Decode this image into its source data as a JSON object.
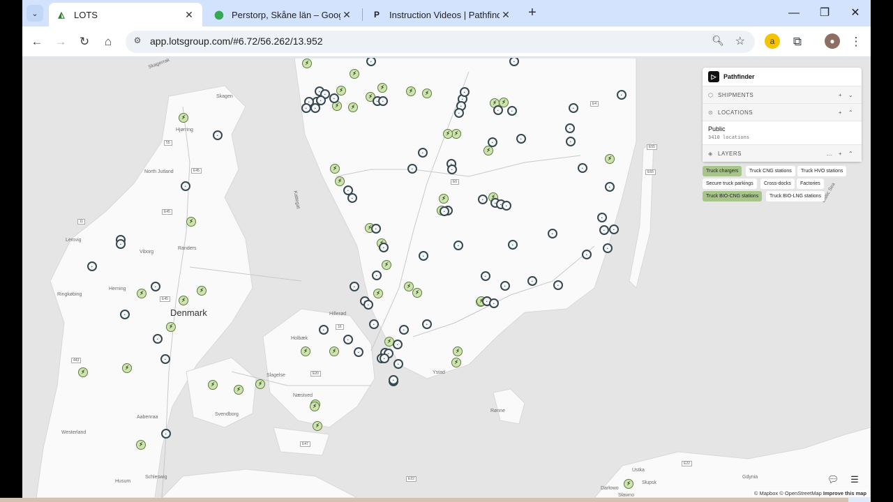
{
  "tabs": [
    {
      "title": "LOTS",
      "favicon": "lots-logo",
      "active": true
    },
    {
      "title": "Perstorp, Skåne län – Google M",
      "favicon": "google-maps-pin"
    },
    {
      "title": "Instruction Videos | Pathfinder",
      "favicon": "P"
    }
  ],
  "address_bar": {
    "url": "app.lotsgroup.com/#6.72/56.262/13.952"
  },
  "panel": {
    "title": "Pathfinder",
    "sections": {
      "shipments": "SHIPMENTS",
      "locations": "LOCATIONS",
      "layers": "LAYERS"
    },
    "location_item": {
      "title": "Public",
      "count": "3410 locations"
    },
    "layer_chips": [
      {
        "label": "Truck chargers",
        "active": true
      },
      {
        "label": "Truck CNG stations",
        "active": false
      },
      {
        "label": "Truck HVO stations",
        "active": false
      },
      {
        "label": "Secure truck parkings",
        "active": false
      },
      {
        "label": "Cross-docks",
        "active": false
      },
      {
        "label": "Factories",
        "active": false
      },
      {
        "label": "Truck BIO-CNG stations",
        "active": true
      },
      {
        "label": "Truck BIO-LNG stations",
        "active": false
      }
    ]
  },
  "map": {
    "country_label": "Denmark",
    "place_labels": [
      "Skagen",
      "Hjørring",
      "North Jutland",
      "Lemvig",
      "Viborg",
      "Randers",
      "Herning",
      "Ringkøbing",
      "Westerland",
      "Aabenraa",
      "Husum",
      "Schleswig",
      "Svendborg",
      "Slagelse",
      "Holbæk",
      "Hillerød",
      "Næstved",
      "Ystad",
      "Rønne",
      "Ustka",
      "Słupsk",
      "Darłowo",
      "Sławno",
      "Gdynia",
      "Kattegat",
      "Baltic Sea",
      "Skagerrak"
    ],
    "road_labels": [
      "55",
      "E45",
      "E45",
      "11",
      "E45",
      "16",
      "E20",
      "E47",
      "443",
      "E55",
      "E65",
      "E6",
      "E4",
      "E22",
      "E22",
      "E20",
      "E28",
      "S6",
      "S6"
    ],
    "attribution": "© Mapbox © OpenStreetMap",
    "improve_link": "Improve this map"
  },
  "colors": {
    "charger_fill": "#cfe3b0",
    "station_border": "#37474f",
    "active_chip": "#a7c589",
    "tabstrip": "#d3e3fd"
  }
}
